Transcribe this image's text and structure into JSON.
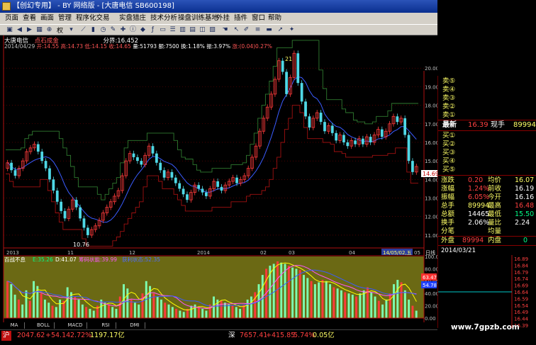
{
  "window": {
    "title": "【创幻专用】 - BY 网络版 - [大唐电信 SB600198]"
  },
  "menu": [
    "页面",
    "查看",
    "画面",
    "管理",
    "程序化交易",
    "实盘猎庄",
    "技术分析",
    "操盘训练基地",
    "外挂",
    "插件",
    "窗口",
    "帮助"
  ],
  "toolbar": {
    "rights_label": "权"
  },
  "stock_header": {
    "name": "大唐电信",
    "indicator": "点石成金",
    "divider": "分界:16.452"
  },
  "bar_info": {
    "date": "2014/04/29",
    "open": "开:14.55",
    "high": "高:14.73",
    "low": "低:14.15",
    "close": "收:14.65",
    "volume": "量:51793",
    "amount": "额:7500",
    "turnover": "换:1.18%",
    "amplitude": "振:3.97%",
    "change": "涨:(0.04)0.27%"
  },
  "colors": {
    "up": "#ff3b3b",
    "down": "#4fd8e6",
    "grid": "#7a0000",
    "yellow": "#ffff00",
    "blue": "#3a5cff",
    "frame": "#b01010"
  },
  "price_axis": [
    "20.00",
    "19.00",
    "18.00",
    "17.00",
    "16.00",
    "15.00",
    "14.00",
    "13.00",
    "12.00",
    "11.00"
  ],
  "marks": {
    "peak_label": "21",
    "low_label": "10.76",
    "last_tag": "14.69"
  },
  "date_axis": {
    "labels": [
      "2013",
      "11",
      "12",
      "2014",
      "02",
      "03",
      "04",
      "05"
    ],
    "current": "14/05/02,五",
    "period": "日线"
  },
  "indicator": {
    "title": "百战不息",
    "e": "E:35.26",
    "d": "D:41.07",
    "chip": "筹码状能:39.99",
    "profit": "获利状态:52.35",
    "axis": [
      "100.00",
      "80.00",
      "60.00",
      "40.00",
      "20.00",
      "0.00"
    ],
    "tag_a": "54.78",
    "tag_b": "63.47",
    "values": [
      60,
      55,
      38,
      30,
      22,
      45,
      28,
      60,
      52,
      40,
      30,
      25,
      20,
      18,
      30,
      28,
      50,
      42,
      35,
      30,
      22,
      18,
      15,
      12,
      20,
      30,
      25,
      22,
      18,
      15,
      35,
      55,
      48,
      30,
      25,
      22,
      40,
      60,
      52,
      40,
      35,
      30,
      25,
      22,
      18,
      15,
      12,
      10,
      15,
      20,
      22,
      18,
      15,
      12,
      22,
      35,
      30,
      28,
      25,
      22,
      20,
      18,
      15,
      22,
      30,
      35,
      42,
      55,
      70,
      80,
      85,
      88,
      92,
      90,
      88,
      85,
      82,
      80,
      78,
      70,
      65,
      60,
      55,
      58,
      62,
      60,
      55,
      50,
      48,
      45,
      42,
      40,
      38,
      35,
      40,
      45,
      50,
      42,
      35,
      28,
      22,
      30,
      40,
      55,
      62,
      58,
      45,
      30,
      20,
      12
    ]
  },
  "tabs": [
    "MA",
    "BOLL",
    "MACD",
    "RSI",
    "DMI"
  ],
  "quote": {
    "sell5": "卖⑤",
    "sell4": "卖④",
    "sell3": "卖③",
    "sell2": "卖②",
    "sell1": "卖①",
    "latest_label": "最新",
    "latest_value": "16.39",
    "lot_label": "现手",
    "lot_value": "89994",
    "buy1": "买①",
    "buy2": "买②",
    "buy3": "买③",
    "buy4": "买④",
    "buy5": "买⑤",
    "rows": [
      {
        "l": "涨跌",
        "lv": "0.20",
        "r": "均价",
        "rv": "16.07"
      },
      {
        "l": "涨幅",
        "lv": "1.24%",
        "r": "前收",
        "rv": "16.19"
      },
      {
        "l": "振幅",
        "lv": "6.05%",
        "r": "今开",
        "rv": "16.16"
      },
      {
        "l": "总手",
        "lv": "89994",
        "r": "最高",
        "rv": "16.48"
      },
      {
        "l": "总额",
        "lv": "14465",
        "r": "最低",
        "rv": "15.50"
      },
      {
        "l": "换手",
        "lv": "2.06%",
        "r": "量比",
        "rv": "2.24"
      }
    ],
    "fenbi": "分笔",
    "junliang": "均量",
    "outer_label": "外盘",
    "outer_value": "89994",
    "inner_label": "内盘",
    "inner_value": "0",
    "tick_date": "2014/03/21",
    "tick_axis": [
      "16.89",
      "16.84",
      "16.79",
      "16.74",
      "16.69",
      "16.64",
      "16.59",
      "16.54",
      "16.49",
      "16.44",
      "16.39"
    ]
  },
  "status": {
    "sh_label": "沪",
    "sh_index": "2047.62",
    "sh_change": "+54.14",
    "sh_pct": "2.72%",
    "sh_amount": "1197.17亿",
    "sz_label": "深",
    "sz_index": "7657.41",
    "sz_change": "+415.85",
    "sz_pct": "5.74%",
    "sz_amount": "0.05亿"
  },
  "watermark": "www.7gpzb.com",
  "chart_data": {
    "type": "candlestick",
    "y_range": [
      10.5,
      21.0
    ],
    "points": [
      [
        14.6,
        14.9
      ],
      [
        14.9,
        14.5
      ],
      [
        14.5,
        14.2
      ],
      [
        14.2,
        14.6
      ],
      [
        14.6,
        15.0
      ],
      [
        15.0,
        15.5
      ],
      [
        15.5,
        15.7
      ],
      [
        15.7,
        15.9
      ],
      [
        15.9,
        15.5
      ],
      [
        15.5,
        15.0
      ],
      [
        15.0,
        14.6
      ],
      [
        14.6,
        14.0
      ],
      [
        14.0,
        13.4
      ],
      [
        13.4,
        12.8
      ],
      [
        12.8,
        12.3
      ],
      [
        12.3,
        11.9
      ],
      [
        11.9,
        12.4
      ],
      [
        12.4,
        12.9
      ],
      [
        12.9,
        12.5
      ],
      [
        12.5,
        11.9
      ],
      [
        11.9,
        11.4
      ],
      [
        11.4,
        11.0
      ],
      [
        11.0,
        11.3
      ],
      [
        11.3,
        11.5
      ],
      [
        11.5,
        11.8
      ],
      [
        11.8,
        12.2
      ],
      [
        12.2,
        12.5
      ],
      [
        12.5,
        12.8
      ],
      [
        12.8,
        13.1
      ],
      [
        13.1,
        13.4
      ],
      [
        13.4,
        14.2
      ],
      [
        14.2,
        15.0
      ],
      [
        15.0,
        15.4
      ],
      [
        15.4,
        15.2
      ],
      [
        15.2,
        15.0
      ],
      [
        15.0,
        14.8
      ],
      [
        14.8,
        15.3
      ],
      [
        15.3,
        15.8
      ],
      [
        15.8,
        15.4
      ],
      [
        15.4,
        14.9
      ],
      [
        14.9,
        14.5
      ],
      [
        14.5,
        14.1
      ],
      [
        14.1,
        14.4
      ],
      [
        14.4,
        14.1
      ],
      [
        14.1,
        13.8
      ],
      [
        13.8,
        13.5
      ],
      [
        13.5,
        13.2
      ],
      [
        13.2,
        12.9
      ],
      [
        12.9,
        13.3
      ],
      [
        13.3,
        13.7
      ],
      [
        13.7,
        13.5
      ],
      [
        13.5,
        13.3
      ],
      [
        13.3,
        13.1
      ],
      [
        13.1,
        13.5
      ],
      [
        13.5,
        13.9
      ],
      [
        13.9,
        13.6
      ],
      [
        13.6,
        13.4
      ],
      [
        13.4,
        13.7
      ],
      [
        13.7,
        13.9
      ],
      [
        13.9,
        14.1
      ],
      [
        14.1,
        13.8
      ],
      [
        13.8,
        14.0
      ],
      [
        14.0,
        14.2
      ],
      [
        14.2,
        14.6
      ],
      [
        14.6,
        15.2
      ],
      [
        15.2,
        15.8
      ],
      [
        15.8,
        16.6
      ],
      [
        16.6,
        17.3
      ],
      [
        17.3,
        17.9
      ],
      [
        17.9,
        18.6
      ],
      [
        18.6,
        19.4
      ],
      [
        19.4,
        20.4
      ],
      [
        20.4,
        19.8
      ],
      [
        19.8,
        18.6
      ],
      [
        18.6,
        19.5
      ],
      [
        19.5,
        20.8
      ],
      [
        20.8,
        19.2
      ],
      [
        19.2,
        18.2
      ],
      [
        18.2,
        17.4
      ],
      [
        17.4,
        16.8
      ],
      [
        16.8,
        17.3
      ],
      [
        17.3,
        17.6
      ],
      [
        17.6,
        17.1
      ],
      [
        17.1,
        16.6
      ],
      [
        16.6,
        16.9
      ],
      [
        16.9,
        16.5
      ],
      [
        16.5,
        16.1
      ],
      [
        16.1,
        16.4
      ],
      [
        16.4,
        16.0
      ],
      [
        16.0,
        15.8
      ],
      [
        15.8,
        16.1
      ],
      [
        16.1,
        15.9
      ],
      [
        15.9,
        16.2
      ],
      [
        16.2,
        15.9
      ],
      [
        15.9,
        16.3
      ],
      [
        16.3,
        16.0
      ],
      [
        16.0,
        16.4
      ],
      [
        16.4,
        16.7
      ],
      [
        16.7,
        16.3
      ],
      [
        16.3,
        16.6
      ],
      [
        16.6,
        17.0
      ],
      [
        17.0,
        17.4
      ],
      [
        17.4,
        17.1
      ],
      [
        17.1,
        17.3
      ],
      [
        17.3,
        16.4
      ],
      [
        16.4,
        15.0
      ],
      [
        15.0,
        14.4
      ],
      [
        14.4,
        14.7
      ]
    ]
  }
}
